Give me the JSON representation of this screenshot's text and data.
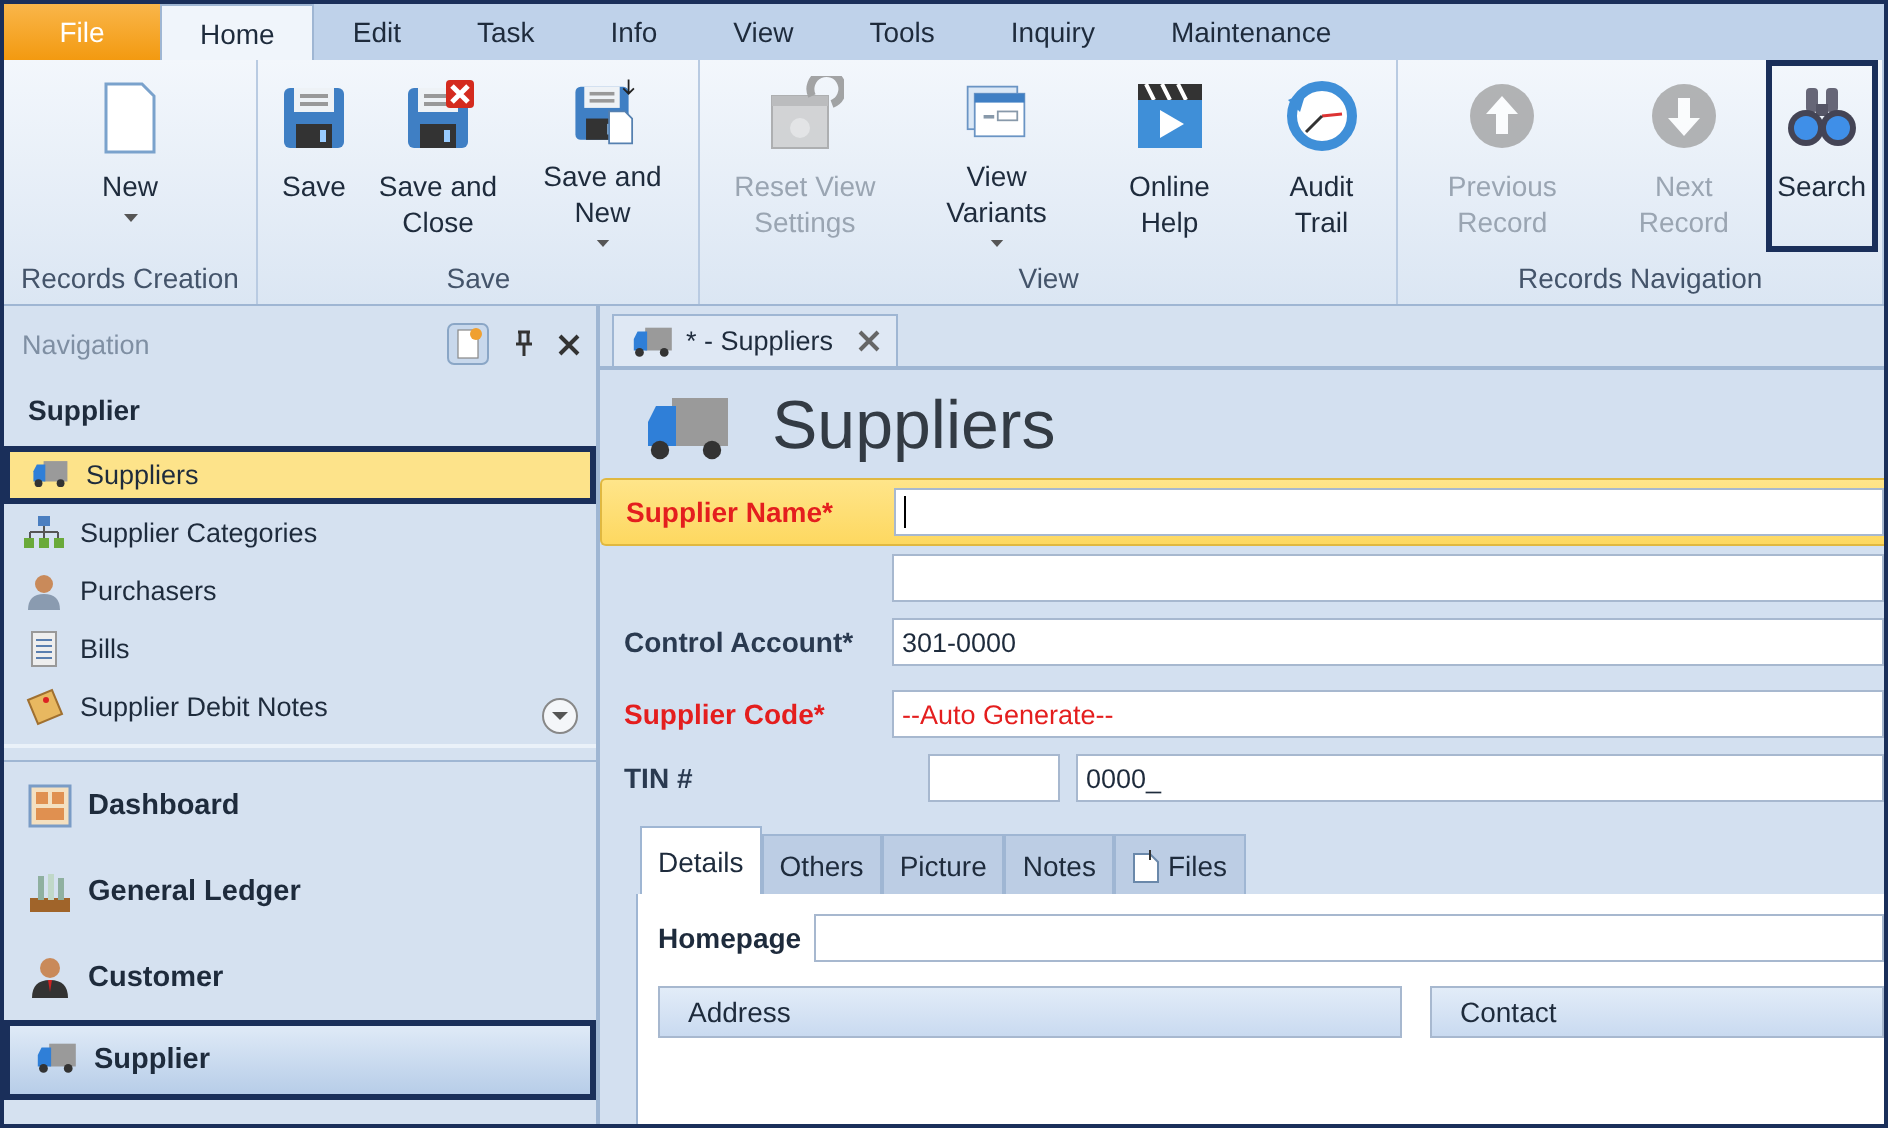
{
  "menu_tabs": [
    {
      "label": "File",
      "kind": "file",
      "selected": false
    },
    {
      "label": "Home",
      "kind": "tab",
      "selected": true
    },
    {
      "label": "Edit",
      "kind": "tab",
      "selected": false
    },
    {
      "label": "Task",
      "kind": "tab",
      "selected": false
    },
    {
      "label": "Info",
      "kind": "tab",
      "selected": false
    },
    {
      "label": "View",
      "kind": "tab",
      "selected": false
    },
    {
      "label": "Tools",
      "kind": "tab",
      "selected": false
    },
    {
      "label": "Inquiry",
      "kind": "tab",
      "selected": false
    },
    {
      "label": "Maintenance",
      "kind": "tab",
      "selected": false
    }
  ],
  "ribbon": {
    "groups": [
      {
        "title": "Records Creation",
        "buttons": [
          {
            "label": "New",
            "dropdown": true,
            "disabled": false,
            "highlighted": false
          }
        ]
      },
      {
        "title": "Save",
        "buttons": [
          {
            "label": "Save",
            "dropdown": false,
            "disabled": false,
            "highlighted": false
          },
          {
            "label": "Save and Close",
            "dropdown": false,
            "disabled": false,
            "highlighted": false
          },
          {
            "label": "Save and New",
            "dropdown": true,
            "disabled": false,
            "highlighted": false
          }
        ]
      },
      {
        "title": "View",
        "buttons": [
          {
            "label": "Reset View Settings",
            "dropdown": false,
            "disabled": true,
            "highlighted": false
          },
          {
            "label": "View Variants",
            "dropdown": true,
            "disabled": false,
            "highlighted": false
          },
          {
            "label": "Online Help",
            "dropdown": false,
            "disabled": false,
            "highlighted": false
          },
          {
            "label": "Audit Trail",
            "dropdown": false,
            "disabled": false,
            "highlighted": false
          }
        ]
      },
      {
        "title": "Records Navigation",
        "buttons": [
          {
            "label": "Previous Record",
            "dropdown": false,
            "disabled": true,
            "highlighted": false
          },
          {
            "label": "Next Record",
            "dropdown": false,
            "disabled": true,
            "highlighted": false
          },
          {
            "label": "Search",
            "dropdown": false,
            "disabled": false,
            "highlighted": true
          }
        ]
      }
    ]
  },
  "navigation": {
    "title": "Navigation",
    "section_title": "Supplier",
    "items": [
      {
        "label": "Suppliers",
        "selected": true
      },
      {
        "label": "Supplier Categories",
        "selected": false
      },
      {
        "label": "Purchasers",
        "selected": false
      },
      {
        "label": "Bills",
        "selected": false
      },
      {
        "label": "Supplier Debit Notes",
        "selected": false
      }
    ],
    "panes": [
      {
        "label": "Dashboard",
        "selected": false
      },
      {
        "label": "General Ledger",
        "selected": false
      },
      {
        "label": "Customer",
        "selected": false
      },
      {
        "label": "Supplier",
        "selected": true
      }
    ]
  },
  "document_tab": {
    "label": "*  - Suppliers"
  },
  "form": {
    "title": "Suppliers",
    "fields": [
      {
        "kind": "text",
        "label": "Supplier Name*",
        "required": true,
        "focused": true,
        "auto": false
      },
      {
        "kind": "text",
        "focused": false
      },
      {
        "kind": "text",
        "label": "Control Account*",
        "value": "301-0000",
        "required": false,
        "focused": false,
        "auto": false
      },
      {
        "kind": "text",
        "label": "Supplier Code*",
        "value": "--Auto Generate--",
        "required": true,
        "focused": false,
        "auto": true
      },
      {
        "kind": "split",
        "label": "TIN #",
        "value": "0000_",
        "required": false,
        "focused": false,
        "auto": false
      }
    ],
    "tabs": [
      {
        "label": "Details",
        "selected": true
      },
      {
        "label": "Others",
        "selected": false
      },
      {
        "label": "Picture",
        "selected": false
      },
      {
        "label": "Notes",
        "selected": false
      },
      {
        "label": "Files",
        "selected": false,
        "icon": true
      }
    ],
    "homepage_label": "Homepage",
    "groups": [
      "Address",
      "Contact"
    ]
  }
}
